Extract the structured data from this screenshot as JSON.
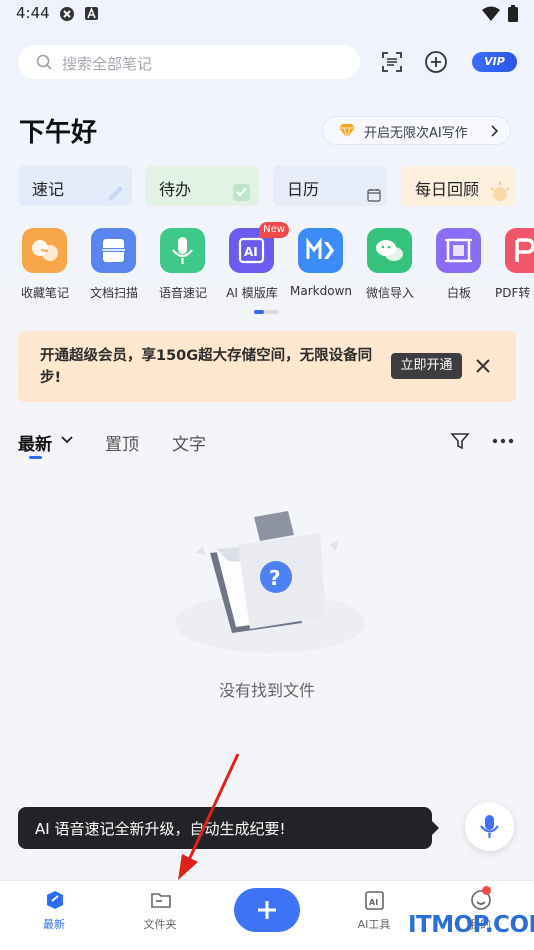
{
  "status_bar": {
    "time": "4:44"
  },
  "header": {
    "search_placeholder": "搜索全部笔记",
    "vip_label": "VIP",
    "greeting": "下午好",
    "ai_promo": "开启无限次AI写作"
  },
  "quick_cards": [
    {
      "label": "速记",
      "bg": "#e3ecfb"
    },
    {
      "label": "待办",
      "bg": "#e2f3e6"
    },
    {
      "label": "日历",
      "bg": "#e6ecf8"
    },
    {
      "label": "每日回顾",
      "bg": "#fdf0df"
    }
  ],
  "tools": [
    {
      "label": "收藏笔记",
      "color": "#f7a74a",
      "icon": "link-heart-icon"
    },
    {
      "label": "文档扫描",
      "color": "#5a84ee",
      "icon": "scanner-icon"
    },
    {
      "label": "语音速记",
      "color": "#3ec98a",
      "icon": "microphone-icon"
    },
    {
      "label": "AI 模版库",
      "color": "#6d5bf0",
      "icon": "ai-template-icon"
    },
    {
      "label": "Markdown",
      "color": "#3b8cf6",
      "icon": "markdown-icon"
    },
    {
      "label": "微信导入",
      "color": "#34c27c",
      "icon": "wechat-icon"
    },
    {
      "label": "白板",
      "color": "#8a6df2",
      "icon": "whiteboard-icon"
    },
    {
      "label": "PDF转",
      "color": "#f0566a",
      "icon": "pdf-icon"
    }
  ],
  "new_badge": "New",
  "promo_banner": {
    "text": "开通超级会员，享150G超大存储空间，无限设备同步!",
    "button": "立即开通"
  },
  "tabs": [
    {
      "label": "最新",
      "active": true
    },
    {
      "label": "置顶",
      "active": false
    },
    {
      "label": "文字",
      "active": false
    }
  ],
  "empty_state": {
    "text": "没有找到文件"
  },
  "toast": {
    "text": "AI 语音速记全新升级，自动生成纪要!"
  },
  "bottom_nav": [
    {
      "label": "最新",
      "active": true,
      "icon": "note-icon"
    },
    {
      "label": "文件夹",
      "active": false,
      "icon": "folder-icon"
    },
    {
      "label": "AI工具",
      "active": false,
      "icon": "ai-tools-icon"
    },
    {
      "label": "我的",
      "active": false,
      "icon": "profile-icon"
    }
  ],
  "watermark": "ITMOP.COM",
  "colors": {
    "accent": "#2f6cf6",
    "promo_bg": "#fde7cf",
    "toast_bg": "#222326"
  }
}
